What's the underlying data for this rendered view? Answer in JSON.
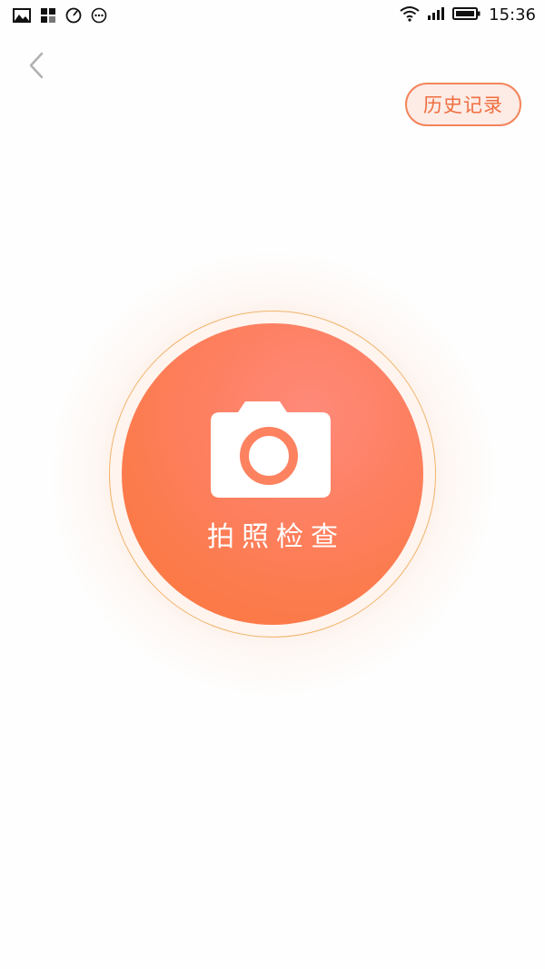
{
  "status_bar": {
    "left_icons": [
      "gallery-icon",
      "app-grid-icon",
      "clock-icon",
      "more-icon"
    ],
    "right_icons": [
      "wifi-icon",
      "signal-icon",
      "battery-icon"
    ],
    "time": "15:36"
  },
  "header": {
    "back_icon": "chevron-left-icon",
    "history_label": "历史记录"
  },
  "main": {
    "camera_icon": "camera-icon",
    "camera_label": "拍照检查"
  },
  "colors": {
    "accent": "#fc7a48",
    "accent_light": "#fdebe5",
    "ring": "#f0b46a",
    "back_icon": "#b0b0b0"
  }
}
